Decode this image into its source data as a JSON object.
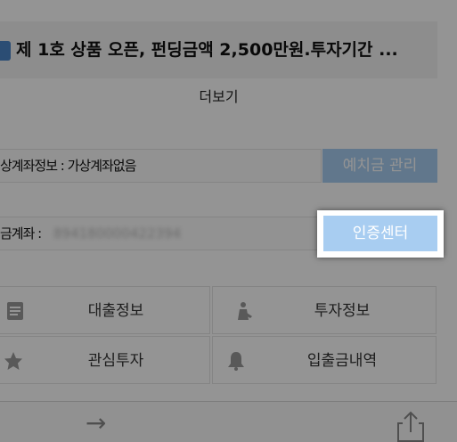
{
  "notice": {
    "text": "제 1호 상품 오픈, 펀딩금액 2,500만원.투자기간 ...",
    "more_label": "더보기"
  },
  "account": {
    "virtual_label": "상계좌정보 : 가상계좌없음",
    "deposit_button": "예치금 관리",
    "bank_label": "금계좌 : ",
    "bank_masked": "894180000422394",
    "cert_button": "인증센터"
  },
  "menu": {
    "items": [
      {
        "label": "대출정보",
        "icon": "document-icon"
      },
      {
        "label": "투자정보",
        "icon": "investor-icon"
      },
      {
        "label": "관심투자",
        "icon": "star-icon"
      },
      {
        "label": "입출금내역",
        "icon": "bell-icon"
      }
    ]
  },
  "colors": {
    "accent": "#a8cdf1",
    "overlay": "rgba(0,0,0,0.42)",
    "notice_icon": "#4a86c8"
  }
}
